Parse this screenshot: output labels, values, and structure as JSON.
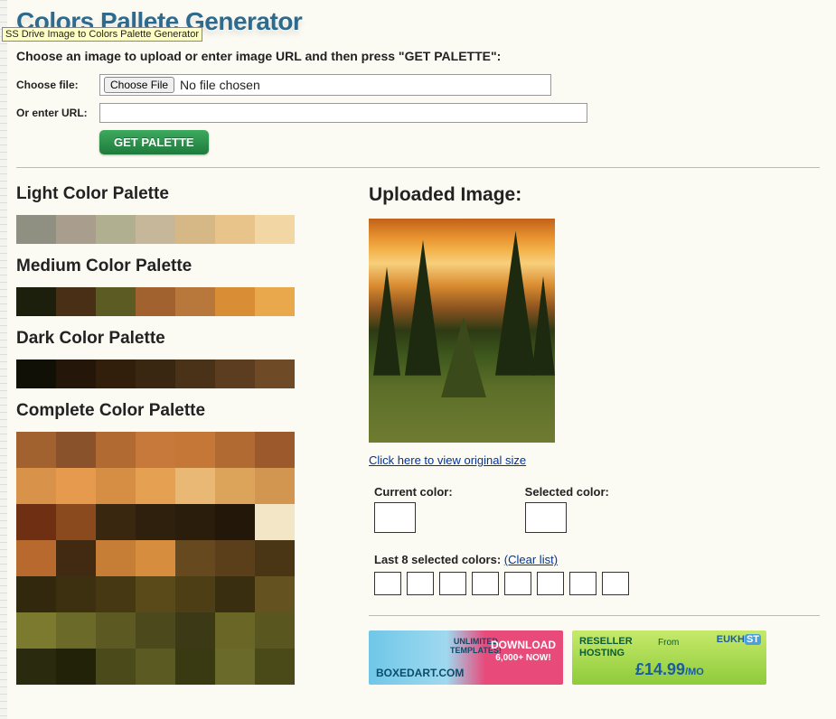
{
  "tooltip": "SS Drive Image to Colors Palette Generator",
  "title": "Colors Pallete Generator",
  "instruction": "Choose an image to upload or enter image URL and then press \"GET PALETTE\":",
  "form": {
    "choose_file_label": "Choose file:",
    "choose_file_button": "Choose File",
    "file_status": "No file chosen",
    "url_label": "Or enter URL:",
    "url_value": "",
    "submit": "GET PALETTE"
  },
  "sections": {
    "light": "Light Color Palette",
    "medium": "Medium Color Palette",
    "dark": "Dark Color Palette",
    "complete": "Complete Color Palette",
    "uploaded": "Uploaded Image:"
  },
  "palettes": {
    "light": [
      "#8f8f82",
      "#a99e8e",
      "#b0b090",
      "#c6b69a",
      "#d6b786",
      "#e8c38a",
      "#f2d7a5"
    ],
    "medium": [
      "#1c1f0c",
      "#4a2f17",
      "#5c5b24",
      "#a2622f",
      "#b8773b",
      "#d98e36",
      "#e9a84c"
    ],
    "dark": [
      "#101006",
      "#241709",
      "#311f0c",
      "#3a2712",
      "#4a3219",
      "#5c3d1f",
      "#6e4b26"
    ],
    "complete": [
      "#a2622f",
      "#8a522a",
      "#b06a32",
      "#c6793a",
      "#c47736",
      "#b06a32",
      "#9c5a2c",
      "#d9924a",
      "#e59a4e",
      "#d68d44",
      "#e6a051",
      "#e9b874",
      "#dca45a",
      "#d29650",
      "#6e2f13",
      "#8a4a1e",
      "#3a2710",
      "#2e200d",
      "#2a1d0b",
      "#221708",
      "#f2e6c6",
      "#b86a2e",
      "#422a12",
      "#c67e36",
      "#d68e3e",
      "#66491e",
      "#5a3f1a",
      "#4a3514",
      "#32280e",
      "#3c3010",
      "#463812",
      "#5a4a1a",
      "#4e3e16",
      "#3a2e10",
      "#645220",
      "#7c7a2e",
      "#6c6a28",
      "#5c5a22",
      "#4c4a1c",
      "#3c3a16",
      "#6a6626",
      "#5a5620",
      "#2a2a0e",
      "#222208",
      "#4a4a1a",
      "#5a5a22",
      "#3a3a12",
      "#6a6a2a",
      "#4a4a18"
    ]
  },
  "right": {
    "view_original": "Click here to view original size",
    "current_color_label": "Current color:",
    "selected_color_label": "Selected color:",
    "last_label": "Last 8 selected colors:",
    "clear_link": "(Clear list)"
  },
  "ads": {
    "a1_brand": "BOXEDART.COM",
    "a1_unlimited1": "UNLIMITED",
    "a1_unlimited2": "TEMPLATES!",
    "a1_download1": "DOWNLOAD",
    "a1_download2": "6,000+ NOW!",
    "a2_rh1": "RESELLER",
    "a2_rh2": "HOSTING",
    "a2_from": "From",
    "a2_price": "£14.99",
    "a2_mo": "/MO",
    "a2_logo1": "EUKH",
    "a2_logo2": "ST"
  }
}
